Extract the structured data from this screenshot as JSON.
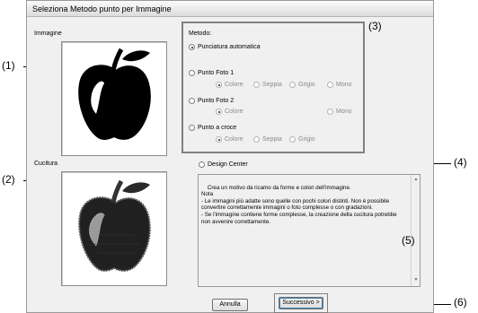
{
  "window": {
    "title": "Seleziona Metodo punto per Immagine"
  },
  "labels": {
    "image": "Immagine",
    "stitch": "Cucitura",
    "method": "Metodo:"
  },
  "options": {
    "auto": {
      "label": "Punciatura automatica",
      "selected": true
    },
    "photo1": {
      "label": "Punto Foto 1",
      "sub": [
        "Colore",
        "Seppia",
        "Grigio",
        "Mono"
      ]
    },
    "photo2": {
      "label": "Punto Foto 2",
      "sub": [
        "Colore",
        "Mono"
      ]
    },
    "cross": {
      "label": "Punto a croce",
      "sub": [
        "Colore",
        "Seppia",
        "Grigio"
      ]
    },
    "design_center": {
      "label": "Design Center"
    }
  },
  "description": "Crea un motivo da ricamo da forme e colori dell'immagine.\nNota\n- Le immagini più adatte sono quelle con pochi colori distinti. Non è possibile\nconvertire correttamente immagini o foto complesse o con gradazioni.\n- Se l'immagine contiene forme complesse, la creazione della cucitura potrebbe\nnon avvenire correttamente.",
  "buttons": {
    "cancel": "Annulla",
    "next": "Successivo >"
  },
  "callouts": [
    "(1)",
    "(2)",
    "(3)",
    "(4)",
    "(5)",
    "(6)"
  ],
  "icons": [
    "apple-image-icon",
    "stitched-apple-icon"
  ]
}
